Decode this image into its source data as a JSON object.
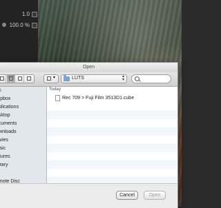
{
  "background": {
    "inspector": {
      "values": [
        "1.0",
        "100.0 %"
      ],
      "percent_icon": "%"
    }
  },
  "dialog": {
    "title": "Open",
    "toolbar": {
      "nav_back": "‹",
      "nav_forward": "›",
      "location": "LUTS",
      "search_placeholder": ""
    },
    "sidebar": {
      "items": [
        {
          "label": "ES",
          "type": "header"
        },
        {
          "label": "ropbox"
        },
        {
          "label": "pplications"
        },
        {
          "label": "esktop"
        },
        {
          "label": "ocuments"
        },
        {
          "label": "ownloads"
        },
        {
          "label": "lovies"
        },
        {
          "label": "lusic"
        },
        {
          "label": "ictures"
        },
        {
          "label": "ibrary"
        },
        {
          "label": ""
        },
        {
          "label": "emote Disc"
        }
      ]
    },
    "content": {
      "section": "Today",
      "files": [
        {
          "name": "Rec 709 > Fuji Film 3513D1.cube"
        }
      ]
    },
    "buttons": {
      "cancel": "Cancel",
      "open": "Open"
    }
  }
}
